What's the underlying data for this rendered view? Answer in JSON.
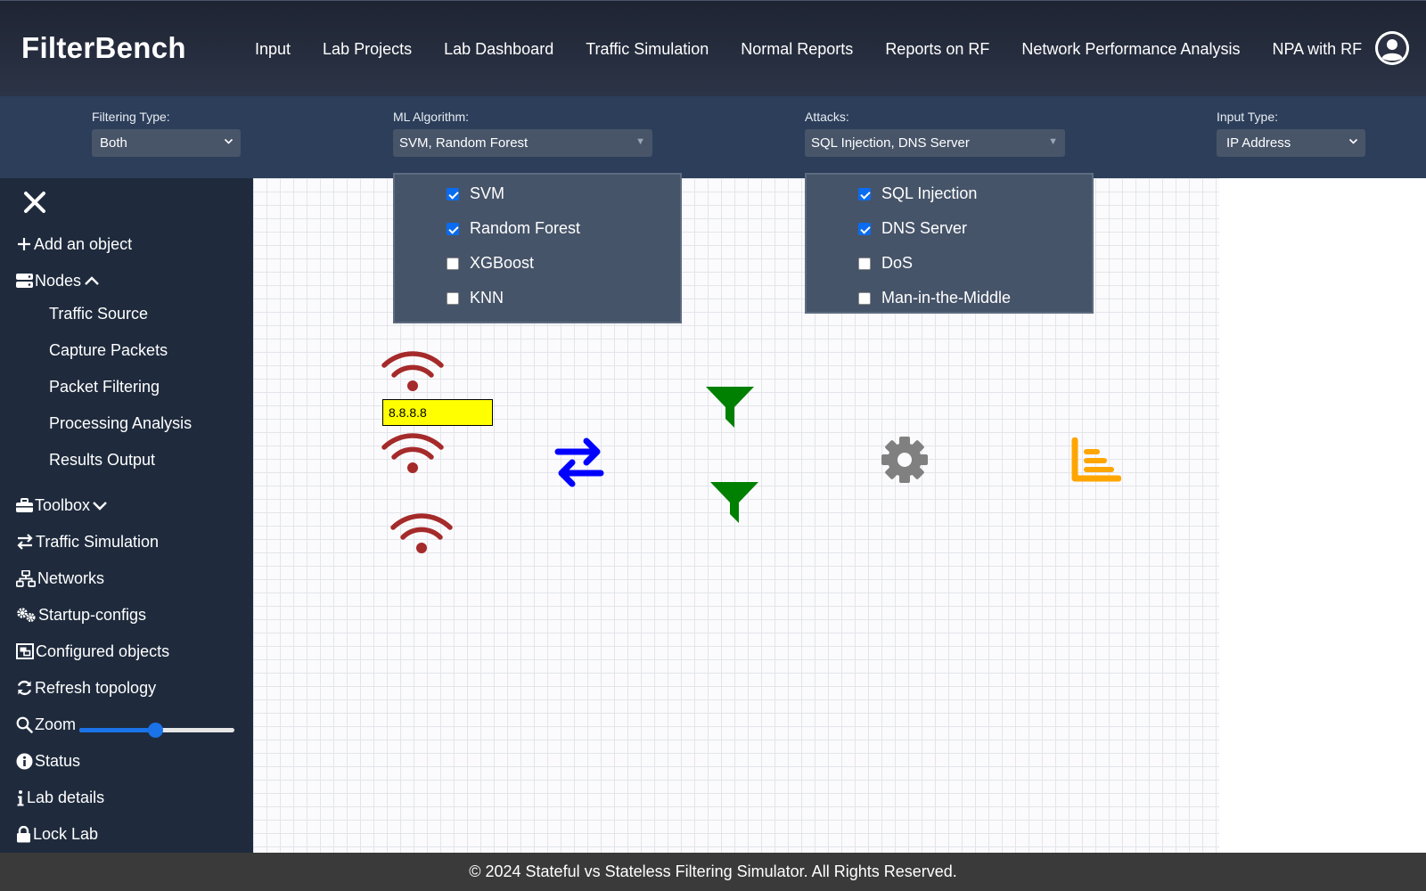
{
  "app": {
    "brand": "FilterBench"
  },
  "nav": {
    "links": [
      "Input",
      "Lab Projects",
      "Lab Dashboard",
      "Traffic Simulation",
      "Normal Reports",
      "Reports on RF",
      "Network Performance Analysis",
      "NPA with RF"
    ],
    "avatar_icon": "user-circle-icon"
  },
  "filters": {
    "filtering_type": {
      "label": "Filtering Type:",
      "value": "Both"
    },
    "ml_algorithm": {
      "label": "ML Algorithm:",
      "value": "SVM, Random Forest",
      "options": [
        {
          "label": "SVM",
          "checked": true
        },
        {
          "label": "Random Forest",
          "checked": true
        },
        {
          "label": "XGBoost",
          "checked": false
        },
        {
          "label": "KNN",
          "checked": false
        }
      ]
    },
    "attacks": {
      "label": "Attacks:",
      "value": "SQL Injection, DNS Server",
      "options": [
        {
          "label": "SQL Injection",
          "checked": true
        },
        {
          "label": "DNS Server",
          "checked": true
        },
        {
          "label": "DoS",
          "checked": false
        },
        {
          "label": "Man-in-the-Middle",
          "checked": false
        }
      ]
    },
    "input_type": {
      "label": "Input Type:",
      "value": "IP Address"
    }
  },
  "sidebar": {
    "close_icon": "close-icon",
    "add_object": "Add an object",
    "nodes": {
      "label": "Nodes",
      "expanded": true,
      "items": [
        "Traffic Source",
        "Capture Packets",
        "Packet Filtering",
        "Processing Analysis",
        "Results Output"
      ]
    },
    "toolbox": {
      "label": "Toolbox",
      "expanded": false
    },
    "items": {
      "traffic_simulation": "Traffic Simulation",
      "networks": "Networks",
      "startup_configs": "Startup-configs",
      "configured_objects": "Configured objects",
      "refresh_topology": "Refresh topology",
      "zoom": "Zoom",
      "status": "Status",
      "lab_details": "Lab details",
      "lock_lab": "Lock Lab"
    },
    "zoom_level": 0.49
  },
  "canvas": {
    "ip_value": "8.8.8.8",
    "colors": {
      "traffic_source": "#a52a2a",
      "capture": "#0000ff",
      "filter": "#008000",
      "processing": "#808080",
      "output": "#ffa500"
    },
    "nodes": [
      {
        "type": "traffic-source",
        "icon": "wifi-icon"
      },
      {
        "type": "traffic-source",
        "icon": "wifi-icon"
      },
      {
        "type": "traffic-source",
        "icon": "wifi-icon"
      },
      {
        "type": "capture-packets",
        "icon": "exchange-arrows-icon"
      },
      {
        "type": "packet-filtering",
        "icon": "filter-icon"
      },
      {
        "type": "packet-filtering",
        "icon": "filter-icon"
      },
      {
        "type": "processing-analysis",
        "icon": "gear-icon"
      },
      {
        "type": "results-output",
        "icon": "bar-chart-icon"
      }
    ]
  },
  "footer": {
    "text": "© 2024 Stateful vs Stateless Filtering Simulator. All Rights Reserved."
  }
}
